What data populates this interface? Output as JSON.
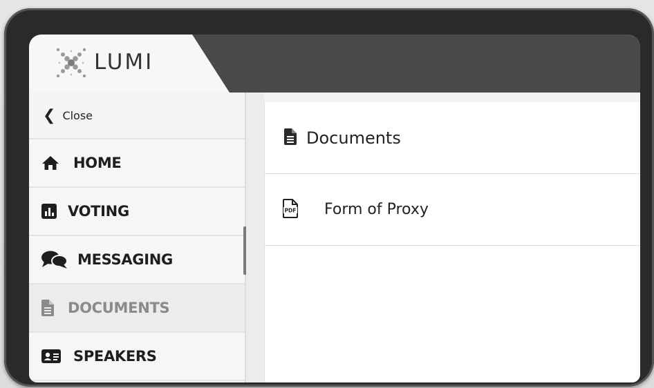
{
  "brand": {
    "name": "LUMI",
    "icon": "lumi-x-logo-icon"
  },
  "sidebar": {
    "close": {
      "label": "Close",
      "icon": "chevron-left-icon"
    },
    "items": [
      {
        "label": "HOME",
        "icon": "home-icon",
        "active": false
      },
      {
        "label": "VOTING",
        "icon": "chart-bar-icon",
        "active": false
      },
      {
        "label": "MESSAGING",
        "icon": "chat-bubbles-icon",
        "active": false
      },
      {
        "label": "DOCUMENTS",
        "icon": "document-icon",
        "active": true
      },
      {
        "label": "SPEAKERS",
        "icon": "id-card-icon",
        "active": false
      }
    ]
  },
  "main": {
    "title": "Documents",
    "title_icon": "document-icon",
    "documents": [
      {
        "name": "Form of Proxy",
        "icon": "pdf-file-icon",
        "icon_text": "PDF"
      }
    ]
  },
  "colors": {
    "header_bg": "#4a4a4a",
    "active_text": "#8a8a8a",
    "text": "#1e1e1e"
  }
}
